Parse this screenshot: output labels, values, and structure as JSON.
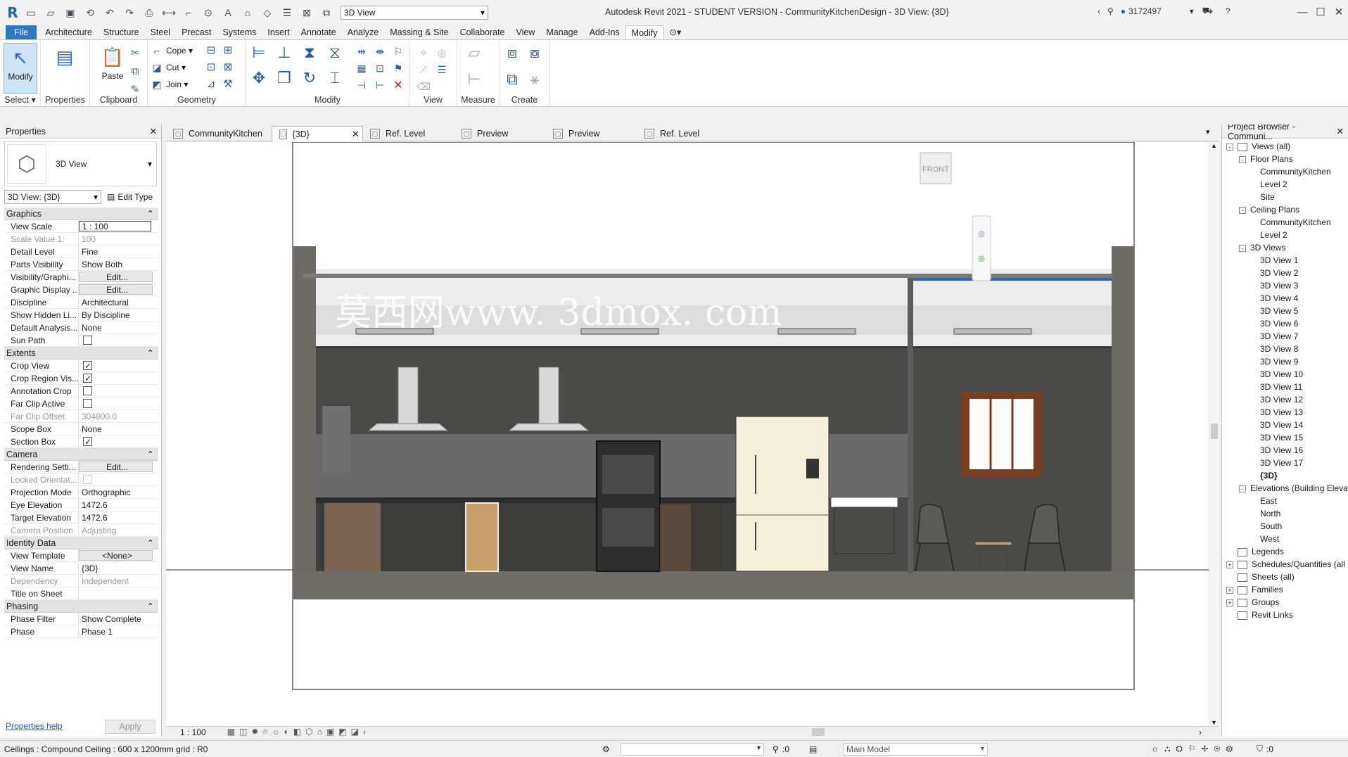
{
  "app": {
    "title": "Autodesk Revit 2021 - STUDENT VERSION - CommunityKitchenDesign - 3D View: {3D}",
    "view_combo": "3D View",
    "user": "3172497"
  },
  "menu": [
    "File",
    "Architecture",
    "Structure",
    "Steel",
    "Precast",
    "Systems",
    "Insert",
    "Annotate",
    "Analyze",
    "Massing & Site",
    "Collaborate",
    "View",
    "Manage",
    "Add-Ins",
    "Modify"
  ],
  "ribbon": {
    "select_label": "Select",
    "modify_label": "Modify",
    "properties_label": "Properties",
    "paste_label": "Paste",
    "clipboard_label": "Clipboard",
    "cope_label": "Cope",
    "cut_label": "Cut",
    "join_label": "Join",
    "geometry_label": "Geometry",
    "modify_panel_label": "Modify",
    "view_label": "View",
    "measure_label": "Measure",
    "create_label": "Create"
  },
  "properties": {
    "header": "Properties",
    "type_name": "3D View",
    "instance": "3D View: {3D}",
    "edit_type": "Edit Type",
    "sections": [
      {
        "name": "Graphics",
        "rows": [
          {
            "k": "View Scale",
            "v": "1 : 100",
            "kind": "input"
          },
          {
            "k": "Scale Value    1:",
            "v": "100",
            "kind": "dim"
          },
          {
            "k": "Detail Level",
            "v": "Fine"
          },
          {
            "k": "Parts Visibility",
            "v": "Show Both"
          },
          {
            "k": "Visibility/Graphi...",
            "v": "Edit...",
            "kind": "btn"
          },
          {
            "k": "Graphic Display ...",
            "v": "Edit...",
            "kind": "btn"
          },
          {
            "k": "Discipline",
            "v": "Architectural"
          },
          {
            "k": "Show Hidden Li...",
            "v": "By Discipline"
          },
          {
            "k": "Default Analysis...",
            "v": "None"
          },
          {
            "k": "Sun Path",
            "v": "",
            "kind": "chk",
            "checked": false
          }
        ]
      },
      {
        "name": "Extents",
        "rows": [
          {
            "k": "Crop View",
            "v": "",
            "kind": "chk",
            "checked": true
          },
          {
            "k": "Crop Region Vis...",
            "v": "",
            "kind": "chk",
            "checked": true
          },
          {
            "k": "Annotation Crop",
            "v": "",
            "kind": "chk",
            "checked": false
          },
          {
            "k": "Far Clip Active",
            "v": "",
            "kind": "chk",
            "checked": false
          },
          {
            "k": "Far Clip Offset",
            "v": "304800.0",
            "kind": "dim"
          },
          {
            "k": "Scope Box",
            "v": "None"
          },
          {
            "k": "Section Box",
            "v": "",
            "kind": "chk",
            "checked": true
          }
        ]
      },
      {
        "name": "Camera",
        "rows": [
          {
            "k": "Rendering Setti...",
            "v": "Edit...",
            "kind": "btn"
          },
          {
            "k": "Locked Orientat...",
            "v": "",
            "kind": "dimchk"
          },
          {
            "k": "Projection Mode",
            "v": "Orthographic"
          },
          {
            "k": "Eye Elevation",
            "v": "1472.6"
          },
          {
            "k": "Target Elevation",
            "v": "1472.6"
          },
          {
            "k": "Camera Position",
            "v": "Adjusting",
            "kind": "dim"
          }
        ]
      },
      {
        "name": "Identity Data",
        "rows": [
          {
            "k": "View Template",
            "v": "<None>",
            "kind": "btn"
          },
          {
            "k": "View Name",
            "v": "{3D}"
          },
          {
            "k": "Dependency",
            "v": "Independent",
            "kind": "dim"
          },
          {
            "k": "Title on Sheet",
            "v": ""
          }
        ]
      },
      {
        "name": "Phasing",
        "rows": [
          {
            "k": "Phase Filter",
            "v": "Show Complete"
          },
          {
            "k": "Phase",
            "v": "Phase 1"
          }
        ]
      }
    ],
    "help": "Properties help",
    "apply": "Apply"
  },
  "tabs": [
    {
      "label": "CommunityKitchen",
      "active": false
    },
    {
      "label": "{3D}",
      "active": true
    },
    {
      "label": "Ref. Level",
      "active": false
    },
    {
      "label": "Preview",
      "active": false
    },
    {
      "label": "Preview",
      "active": false
    },
    {
      "label": "Ref. Level",
      "active": false
    }
  ],
  "canvas": {
    "viewcube_face": "FRONT",
    "watermark": "莫西网www. 3dmox. com"
  },
  "view_bar": {
    "scale": "1 : 100"
  },
  "browser": {
    "header": "Project Browser - Communi...",
    "items": [
      {
        "t": "Views (all)",
        "lvl": 0,
        "tw": "-"
      },
      {
        "t": "Floor Plans",
        "lvl": 1,
        "tw": "-"
      },
      {
        "t": "CommunityKitchen",
        "lvl": 2
      },
      {
        "t": "Level 2",
        "lvl": 2
      },
      {
        "t": "Site",
        "lvl": 2
      },
      {
        "t": "Ceiling Plans",
        "lvl": 1,
        "tw": "-"
      },
      {
        "t": "CommunityKitchen",
        "lvl": 2
      },
      {
        "t": "Level 2",
        "lvl": 2
      },
      {
        "t": "3D Views",
        "lvl": 1,
        "tw": "-"
      },
      {
        "t": "3D View 1",
        "lvl": 2
      },
      {
        "t": "3D View 2",
        "lvl": 2
      },
      {
        "t": "3D View 3",
        "lvl": 2
      },
      {
        "t": "3D View 4",
        "lvl": 2
      },
      {
        "t": "3D View 5",
        "lvl": 2
      },
      {
        "t": "3D View 6",
        "lvl": 2
      },
      {
        "t": "3D View 7",
        "lvl": 2
      },
      {
        "t": "3D View 8",
        "lvl": 2
      },
      {
        "t": "3D View 9",
        "lvl": 2
      },
      {
        "t": "3D View 10",
        "lvl": 2
      },
      {
        "t": "3D View 11",
        "lvl": 2
      },
      {
        "t": "3D View 12",
        "lvl": 2
      },
      {
        "t": "3D View 13",
        "lvl": 2
      },
      {
        "t": "3D View 14",
        "lvl": 2
      },
      {
        "t": "3D View 15",
        "lvl": 2
      },
      {
        "t": "3D View 16",
        "lvl": 2
      },
      {
        "t": "3D View 17",
        "lvl": 2
      },
      {
        "t": "{3D}",
        "lvl": 2,
        "sel": true
      },
      {
        "t": "Elevations (Building Eleva",
        "lvl": 1,
        "tw": "-"
      },
      {
        "t": "East",
        "lvl": 2
      },
      {
        "t": "North",
        "lvl": 2
      },
      {
        "t": "South",
        "lvl": 2
      },
      {
        "t": "West",
        "lvl": 2
      },
      {
        "t": "Legends",
        "lvl": 0,
        "icon": true
      },
      {
        "t": "Schedules/Quantities (all",
        "lvl": 0,
        "tw": "+",
        "icon": true
      },
      {
        "t": "Sheets (all)",
        "lvl": 0,
        "icon": true
      },
      {
        "t": "Families",
        "lvl": 0,
        "tw": "+",
        "icon": true
      },
      {
        "t": "Groups",
        "lvl": 0,
        "tw": "+",
        "icon": true
      },
      {
        "t": "Revit Links",
        "lvl": 0,
        "icon": true
      }
    ]
  },
  "status": {
    "message": "Ceilings : Compound Ceiling : 600 x 1200mm grid : R0",
    "count": ":0",
    "model": "Main Model",
    "filter": ":0"
  }
}
